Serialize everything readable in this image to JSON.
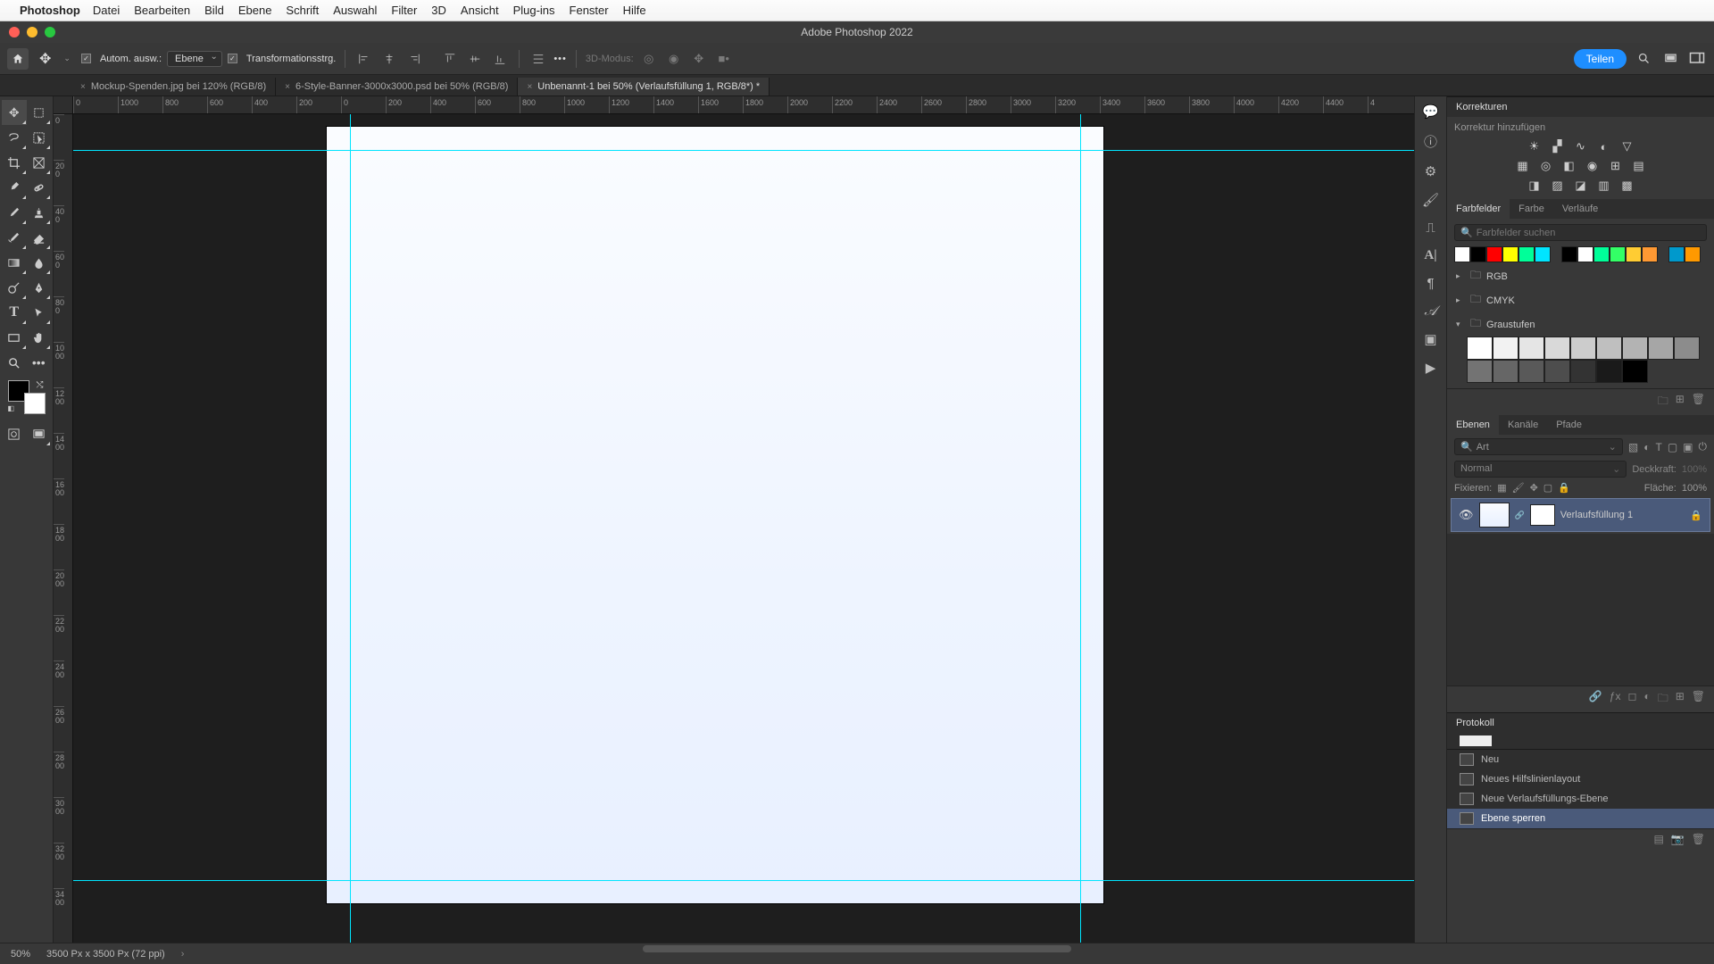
{
  "menubar": {
    "app_name": "Photoshop",
    "items": [
      "Datei",
      "Bearbeiten",
      "Bild",
      "Ebene",
      "Schrift",
      "Auswahl",
      "Filter",
      "3D",
      "Ansicht",
      "Plug-ins",
      "Fenster",
      "Hilfe"
    ]
  },
  "window_title": "Adobe Photoshop 2022",
  "options_bar": {
    "auto_select_label": "Autom. ausw.:",
    "auto_select_target": "Ebene",
    "transform_controls_label": "Transformationsstrg.",
    "three_d_label": "3D-Modus:",
    "share_label": "Teilen"
  },
  "tabs": [
    {
      "label": "Mockup-Spenden.jpg bei 120% (RGB/8)",
      "active": false
    },
    {
      "label": "6-Style-Banner-3000x3000.psd bei 50% (RGB/8)",
      "active": false
    },
    {
      "label": "Unbenannt-1 bei 50% (Verlaufsfüllung 1, RGB/8*) *",
      "active": true
    }
  ],
  "ruler_h": [
    "0",
    "1000",
    "800",
    "600",
    "400",
    "200",
    "0",
    "200",
    "400",
    "600",
    "800",
    "1000",
    "1200",
    "1400",
    "1600",
    "1800",
    "2000",
    "2200",
    "2400",
    "2600",
    "2800",
    "3000",
    "3200",
    "3400",
    "3600",
    "3800",
    "4000",
    "4200",
    "4400",
    "4"
  ],
  "ruler_v": [
    "0",
    "200",
    "400",
    "600",
    "800",
    "1000",
    "1200",
    "1400",
    "1600",
    "1800",
    "2000",
    "2200",
    "2400",
    "2600",
    "2800",
    "3000",
    "3200",
    "3400"
  ],
  "status": {
    "zoom": "50%",
    "doc_info": "3500 Px x 3500 Px (72 ppi)"
  },
  "panels": {
    "adjustments": {
      "title": "Korrekturen",
      "add_label": "Korrektur hinzufügen"
    },
    "swatches": {
      "tabs": [
        "Farbfelder",
        "Farbe",
        "Verläufe"
      ],
      "search_placeholder": "Farbfelder suchen",
      "basic_colors_a": [
        "#ffffff",
        "#000000",
        "#ff0000",
        "#ffff00",
        "#00ff99",
        "#00e5ff"
      ],
      "basic_colors_b": [
        "#000000",
        "#ffffff",
        "#00ff99",
        "#33ff66",
        "#ffcc33",
        "#ff9933"
      ],
      "basic_colors_c": [
        "#0099cc",
        "#ff9900"
      ],
      "groups": [
        {
          "name": "RGB",
          "open": false
        },
        {
          "name": "CMYK",
          "open": false
        },
        {
          "name": "Graustufen",
          "open": true
        }
      ],
      "grays": [
        "#ffffff",
        "#f2f2f2",
        "#e5e5e5",
        "#d9d9d9",
        "#cccccc",
        "#bfbfbf",
        "#b3b3b3",
        "#a6a6a6",
        "#8c8c8c",
        "#737373",
        "#666666",
        "#595959",
        "#4d4d4d",
        "#333333",
        "#1a1a1a",
        "#000000"
      ]
    },
    "layers": {
      "tabs": [
        "Ebenen",
        "Kanäle",
        "Pfade"
      ],
      "filter_label": "Art",
      "blend_mode": "Normal",
      "opacity_label": "Deckkraft:",
      "opacity_value": "100%",
      "lock_label": "Fixieren:",
      "fill_label": "Fläche:",
      "fill_value": "100%",
      "layer_name": "Verlaufsfüllung 1"
    },
    "history": {
      "title": "Protokoll",
      "items": [
        "Neu",
        "Neues Hilfslinienlayout",
        "Neue Verlaufsfüllungs-Ebene",
        "Ebene sperren"
      ]
    }
  }
}
